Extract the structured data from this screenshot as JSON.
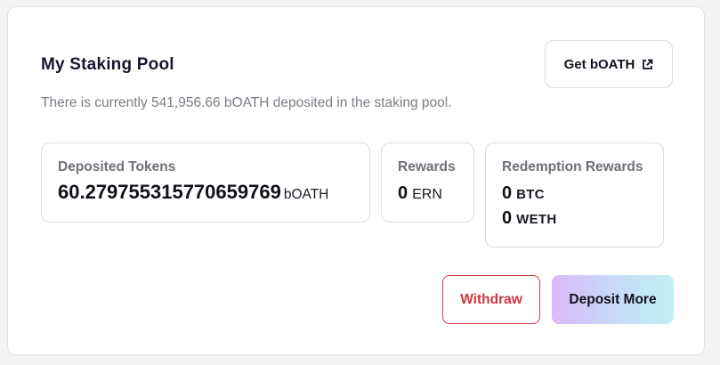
{
  "pool": {
    "title": "My Staking Pool",
    "subtitle": "There is currently 541,956.66 bOATH deposited in the staking pool."
  },
  "get_button": {
    "label": "Get bOATH",
    "icon": "external-link-icon"
  },
  "stats": {
    "deposited": {
      "label": "Deposited Tokens",
      "value": "60.279755315770659769",
      "unit": "bOATH"
    },
    "rewards": {
      "label": "Rewards",
      "value": "0",
      "unit": "ERN"
    },
    "redemption": {
      "label": "Redemption Rewards",
      "items": [
        {
          "value": "0",
          "unit": "BTC"
        },
        {
          "value": "0",
          "unit": "WETH"
        }
      ]
    }
  },
  "actions": {
    "withdraw_label": "Withdraw",
    "deposit_label": "Deposit More"
  },
  "colors": {
    "withdraw_accent": "#d0363f",
    "deposit_gradient_start": "#d9baf7",
    "deposit_gradient_end": "#bff0f5"
  }
}
